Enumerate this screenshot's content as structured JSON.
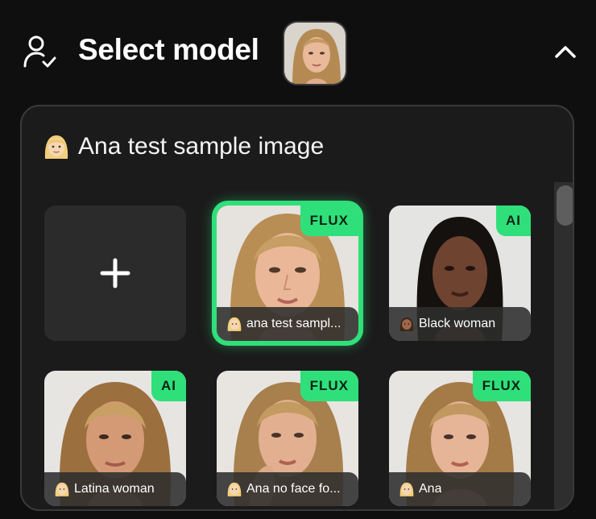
{
  "header": {
    "title": "Select model",
    "icon": "user-check-icon",
    "collapse_icon": "chevron-up-icon"
  },
  "panel": {
    "heading": "Ana test sample image",
    "heading_emoji": "woman-blond-hair-emoji"
  },
  "add_card": {
    "icon": "plus-icon"
  },
  "models": [
    {
      "name": "ana test sampl...",
      "badge": "FLUX",
      "selected": true,
      "emoji": "woman-blond-hair-emoji"
    },
    {
      "name": "Black woman",
      "badge": "AI",
      "selected": false,
      "emoji": "woman-medium-dark-skin-emoji"
    },
    {
      "name": "Latina woman",
      "badge": "AI",
      "selected": false,
      "emoji": "woman-blond-hair-emoji"
    },
    {
      "name": "Ana no face fo...",
      "badge": "FLUX",
      "selected": false,
      "emoji": "woman-blond-hair-emoji"
    },
    {
      "name": "Ana",
      "badge": "FLUX",
      "selected": false,
      "emoji": "woman-blond-hair-emoji"
    }
  ],
  "colors": {
    "accent": "#2fe07a",
    "background": "#0f0f0f",
    "panel": "#1b1b1b"
  }
}
